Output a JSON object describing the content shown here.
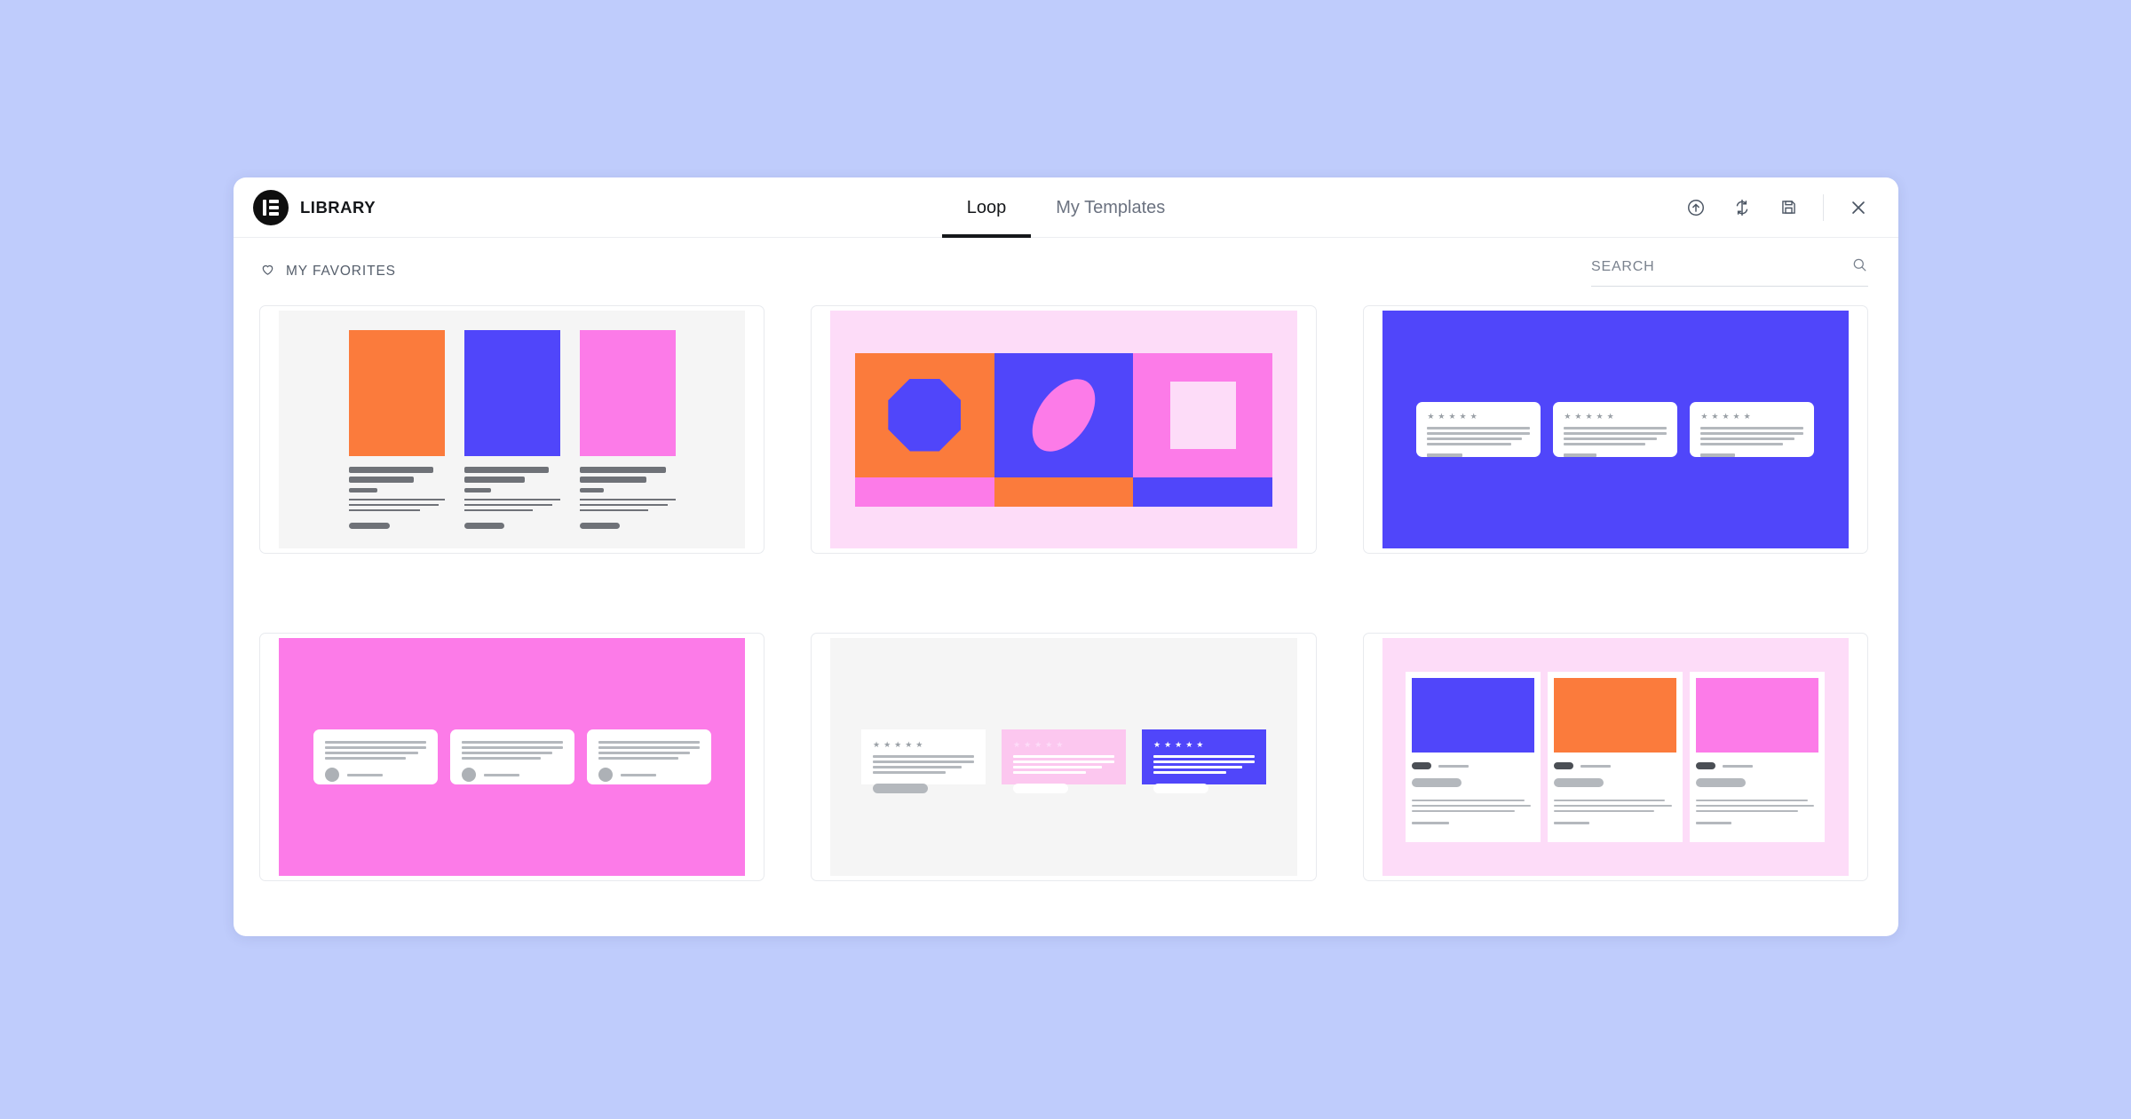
{
  "app": {
    "brand": "LIBRARY",
    "logo_icon": "elementor-logo-icon",
    "background_color": "#bfccfc"
  },
  "header": {
    "tabs": [
      {
        "label": "Loop",
        "active": true
      },
      {
        "label": "My Templates",
        "active": false
      }
    ],
    "actions": [
      {
        "name": "upload-icon",
        "title": "Import Template"
      },
      {
        "name": "sync-icon",
        "title": "Sync Library"
      },
      {
        "name": "save-icon",
        "title": "Save"
      },
      {
        "name": "close-icon",
        "title": "Close"
      }
    ]
  },
  "subbar": {
    "favorites_label": "MY FAVORITES",
    "favorites_icon": "heart-icon",
    "search": {
      "placeholder": "SEARCH",
      "value": "",
      "icon": "search-icon"
    }
  },
  "palette": {
    "orange": "#fb7b3c",
    "blue": "#5046fa",
    "pink": "#fc7be8",
    "light_pink": "#fddcf8",
    "light_grey": "#f5f5f5",
    "white": "#ffffff",
    "grey_text": "#6f7278"
  },
  "templates": [
    {
      "id": "t1",
      "name": "three-column-feature",
      "background": "#f5f5f5",
      "columns": [
        {
          "image_color": "#fb7b3c"
        },
        {
          "image_color": "#5046fa"
        },
        {
          "image_color": "#fc7be8"
        }
      ]
    },
    {
      "id": "t2",
      "name": "color-block-gallery",
      "background": "#fddcf8",
      "cells": [
        {
          "bg": "#fb7b3c",
          "shape": "octagon",
          "shape_color": "#5046fa"
        },
        {
          "bg": "#5046fa",
          "shape": "ellipse",
          "shape_color": "#fc7be8"
        },
        {
          "bg": "#fc7be8",
          "shape": "square",
          "shape_color": "#fddcf8"
        }
      ],
      "strip": [
        "#fc7be8",
        "#fb7b3c",
        "#5046fa"
      ]
    },
    {
      "id": "t3",
      "name": "testimonial-carousel-blue",
      "background": "#5046fa",
      "cards": [
        {
          "bg": "#ffffff",
          "stars": 5
        },
        {
          "bg": "#ffffff",
          "stars": 5
        },
        {
          "bg": "#ffffff",
          "stars": 5
        }
      ]
    },
    {
      "id": "t4",
      "name": "quote-cards-pink",
      "background": "#fc7be8",
      "cards": [
        {
          "bg": "#ffffff",
          "avatar": true
        },
        {
          "bg": "#ffffff",
          "avatar": true
        },
        {
          "bg": "#ffffff",
          "avatar": true
        }
      ]
    },
    {
      "id": "t5",
      "name": "review-tiles-grey",
      "background": "#f5f5f5",
      "cards": [
        {
          "bg": "#ffffff",
          "stars": 5,
          "line_color": "#b4b8bd",
          "button_color": "#b4b8bd"
        },
        {
          "bg": "#fcc7ef",
          "stars": 5,
          "line_color": "#ffffff",
          "button_color": "#ffffff"
        },
        {
          "bg": "#5046fa",
          "stars": 5,
          "line_color": "#ffffff",
          "button_color": "#ffffff"
        }
      ]
    },
    {
      "id": "t6",
      "name": "blog-post-cards",
      "background": "#fddcf8",
      "cards": [
        {
          "image_color": "#5046fa"
        },
        {
          "image_color": "#fb7b3c"
        },
        {
          "image_color": "#fc7be8"
        }
      ]
    }
  ]
}
